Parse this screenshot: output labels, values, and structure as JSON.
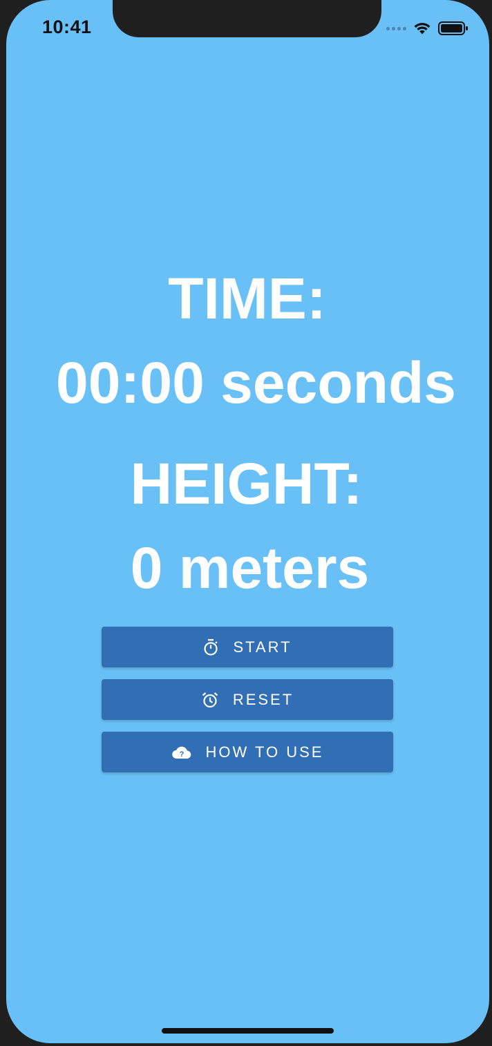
{
  "status_bar": {
    "time": "10:41",
    "signal_icon": "signal-dots-icon",
    "wifi_icon": "wifi-icon",
    "battery_icon": "battery-icon"
  },
  "main": {
    "time_label": "TIME:",
    "time_value": "00:00 seconds",
    "height_label": "HEIGHT:",
    "height_value": "0 meters"
  },
  "buttons": {
    "start": {
      "label": "START",
      "icon": "stopwatch-icon"
    },
    "reset": {
      "label": "RESET",
      "icon": "alarm-clock-icon"
    },
    "how_to_use": {
      "label": "HOW TO USE",
      "icon": "cloud-question-icon"
    }
  },
  "colors": {
    "background": "#68c0f6",
    "button": "#316eb3",
    "text": "#ffffff"
  }
}
